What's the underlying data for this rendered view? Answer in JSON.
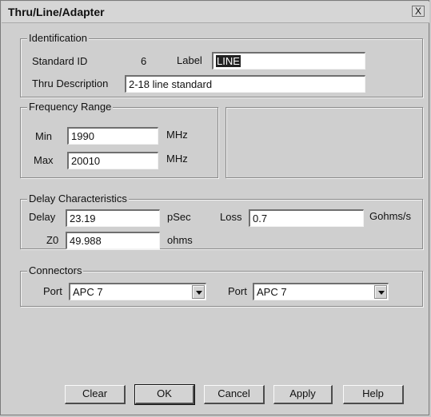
{
  "window": {
    "title": "Thru/Line/Adapter",
    "close_glyph": "X"
  },
  "identification": {
    "legend": "Identification",
    "standard_id_label": "Standard ID",
    "standard_id_value": "6",
    "label_label": "Label",
    "label_value": "LINE",
    "thru_desc_label": "Thru Description",
    "thru_desc_value": "2-18 line standard"
  },
  "frequency": {
    "legend": "Frequency Range",
    "min_label": "Min",
    "min_value": "1990",
    "min_unit": "MHz",
    "max_label": "Max",
    "max_value": "20010",
    "max_unit": "MHz"
  },
  "delay": {
    "legend": "Delay Characteristics",
    "delay_label": "Delay",
    "delay_value": "23.19",
    "delay_unit": "pSec",
    "loss_label": "Loss",
    "loss_value": "0.7",
    "loss_unit": "Gohms/s",
    "z0_label": "Z0",
    "z0_value": "49.988",
    "z0_unit": "ohms"
  },
  "connectors": {
    "legend": "Connectors",
    "port1_label": "Port",
    "port1_value": "APC 7",
    "port2_label": "Port",
    "port2_value": "APC 7"
  },
  "buttons": {
    "clear": "Clear",
    "ok": "OK",
    "cancel": "Cancel",
    "apply": "Apply",
    "help": "Help"
  }
}
